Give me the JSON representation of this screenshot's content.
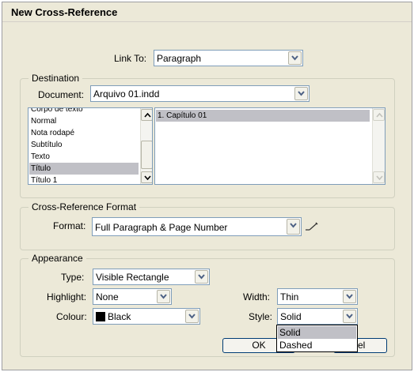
{
  "window": {
    "title": "New Cross-Reference"
  },
  "link_to": {
    "label": "Link To:",
    "value": "Paragraph"
  },
  "destination": {
    "legend": "Destination",
    "document_label": "Document:",
    "document_value": "Arquivo 01.indd",
    "styles": [
      "Corpo de texto",
      "Normal",
      "Nota rodapé",
      "Subtítulo",
      "Texto",
      "Título",
      "Título 1"
    ],
    "selected_style": "Título",
    "paragraphs": [
      "1. Capítulo 01"
    ]
  },
  "format": {
    "legend": "Cross-Reference Format",
    "label": "Format:",
    "value": "Full Paragraph & Page Number"
  },
  "appearance": {
    "legend": "Appearance",
    "type_label": "Type:",
    "type_value": "Visible Rectangle",
    "highlight_label": "Highlight:",
    "highlight_value": "None",
    "colour_label": "Colour:",
    "colour_value": "Black",
    "width_label": "Width:",
    "width_value": "Thin",
    "style_label": "Style:",
    "style_value": "Solid",
    "style_options": [
      "Solid",
      "Dashed"
    ],
    "colour_swatch": "#000000"
  },
  "buttons": {
    "ok": "OK",
    "cancel_partial": "el"
  }
}
